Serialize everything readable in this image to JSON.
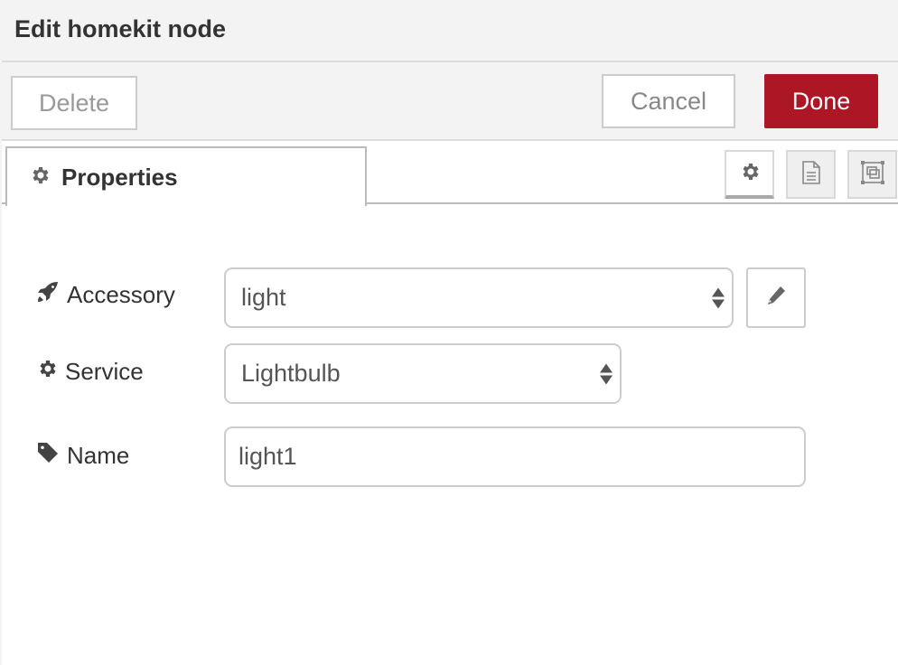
{
  "header": {
    "title": "Edit homekit node"
  },
  "toolbar": {
    "delete_label": "Delete",
    "cancel_label": "Cancel",
    "done_label": "Done",
    "done_color": "#ad1625"
  },
  "tabs": {
    "properties_label": "Properties",
    "icon_buttons": [
      {
        "name": "settings",
        "icon": "gear-icon",
        "active": true
      },
      {
        "name": "description",
        "icon": "document-icon",
        "active": false
      },
      {
        "name": "appearance",
        "icon": "frame-icon",
        "active": false
      }
    ]
  },
  "form": {
    "accessory": {
      "label": "Accessory",
      "icon": "rocket-icon",
      "value": "light"
    },
    "service": {
      "label": "Service",
      "icon": "gear-icon",
      "value": "Lightbulb"
    },
    "name": {
      "label": "Name",
      "icon": "tag-icon",
      "value": "light1"
    }
  }
}
